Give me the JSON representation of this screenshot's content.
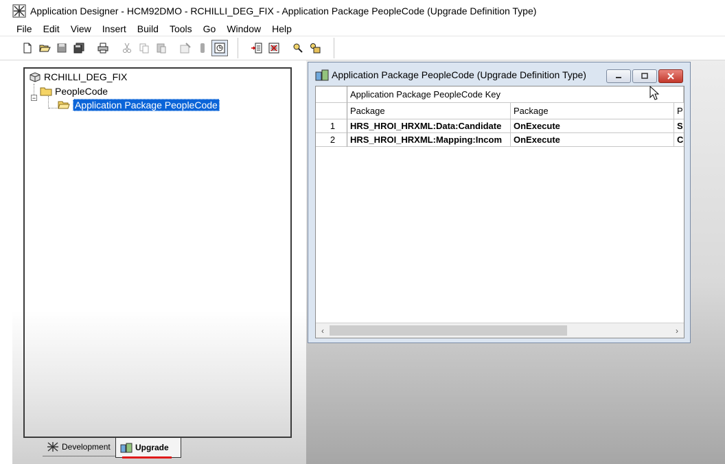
{
  "window": {
    "title": "Application Designer - HCM92DMO - RCHILLI_DEG_FIX - Application Package PeopleCode (Upgrade Definition Type)"
  },
  "menu": [
    "File",
    "Edit",
    "View",
    "Insert",
    "Build",
    "Tools",
    "Go",
    "Window",
    "Help"
  ],
  "toolbar": {
    "icons": [
      "new-icon",
      "open-icon",
      "save-icon",
      "save-all-icon",
      "print-icon",
      "cut-icon",
      "copy-icon",
      "paste-icon",
      "properties-icon",
      "find-icon",
      "project-view-icon",
      "insert-into-project-icon",
      "remove-from-project-icon",
      "find-definition-icon",
      "find-in-icon"
    ]
  },
  "tree": {
    "project": "RCHILLI_DEG_FIX",
    "folder": "PeopleCode",
    "selected_item": "Application Package PeopleCode"
  },
  "tabs": {
    "development": "Development",
    "upgrade": "Upgrade"
  },
  "child_window": {
    "title": "Application Package PeopleCode (Upgrade Definition Type)",
    "group_header": "Application Package PeopleCode Key",
    "columns": [
      "Package",
      "Package",
      "P"
    ],
    "rows": [
      {
        "num": "1",
        "c1": "HRS_HROI_HRXML:Data:Candidate",
        "c2": "OnExecute",
        "c3": "S"
      },
      {
        "num": "2",
        "c1": "HRS_HROI_HRXML:Mapping:Incom",
        "c2": "OnExecute",
        "c3": "C"
      }
    ]
  },
  "colors": {
    "selection": "#0a64d8",
    "tab_underline": "#e01a1a",
    "child_frame": "#dbe5f1"
  }
}
